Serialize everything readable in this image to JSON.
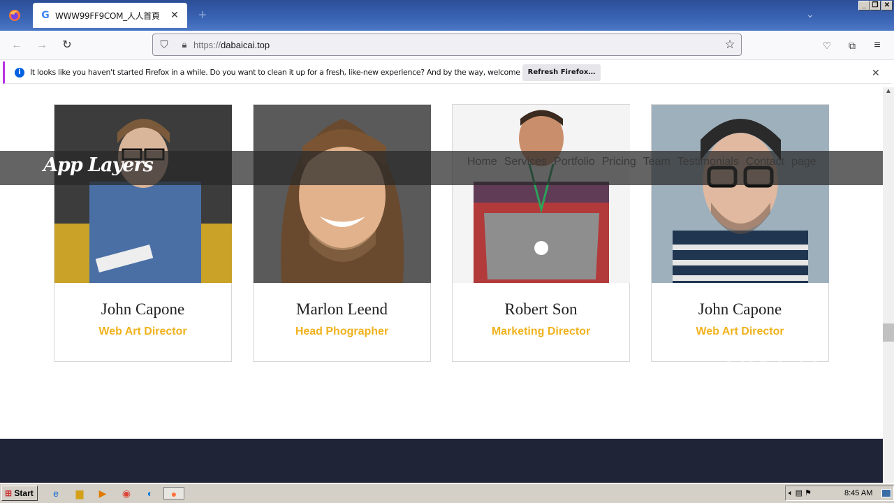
{
  "browser": {
    "tab_title": "WWW99FF9COM_人人首頁",
    "tab_favicon": "G",
    "url_protocol": "https://",
    "url_host": "dabaicai.top"
  },
  "notification": {
    "message": "It looks like you haven't started Firefox in a while. Do you want to clean it up for a fresh, like-new experience? And by the way, welcome back!",
    "button": "Refresh Firefox…"
  },
  "site": {
    "brand": "App Layers",
    "menu": [
      "Home",
      "Services",
      "Portfolio",
      "Pricing",
      "Team",
      "Testimonials",
      "Contact",
      "page"
    ],
    "team": [
      {
        "name": "John Capone",
        "role": "Web Art Director"
      },
      {
        "name": "Marlon Leend",
        "role": "Head Phographer"
      },
      {
        "name": "Robert Son",
        "role": "Marketing Director"
      },
      {
        "name": "John Capone",
        "role": "Web Art Director"
      }
    ]
  },
  "watermark": "ANY ▷ RUN",
  "taskbar": {
    "start": "Start",
    "clock": "8:45 AM"
  },
  "colors": {
    "accent": "#f0b21e",
    "footer": "#1f2536"
  }
}
